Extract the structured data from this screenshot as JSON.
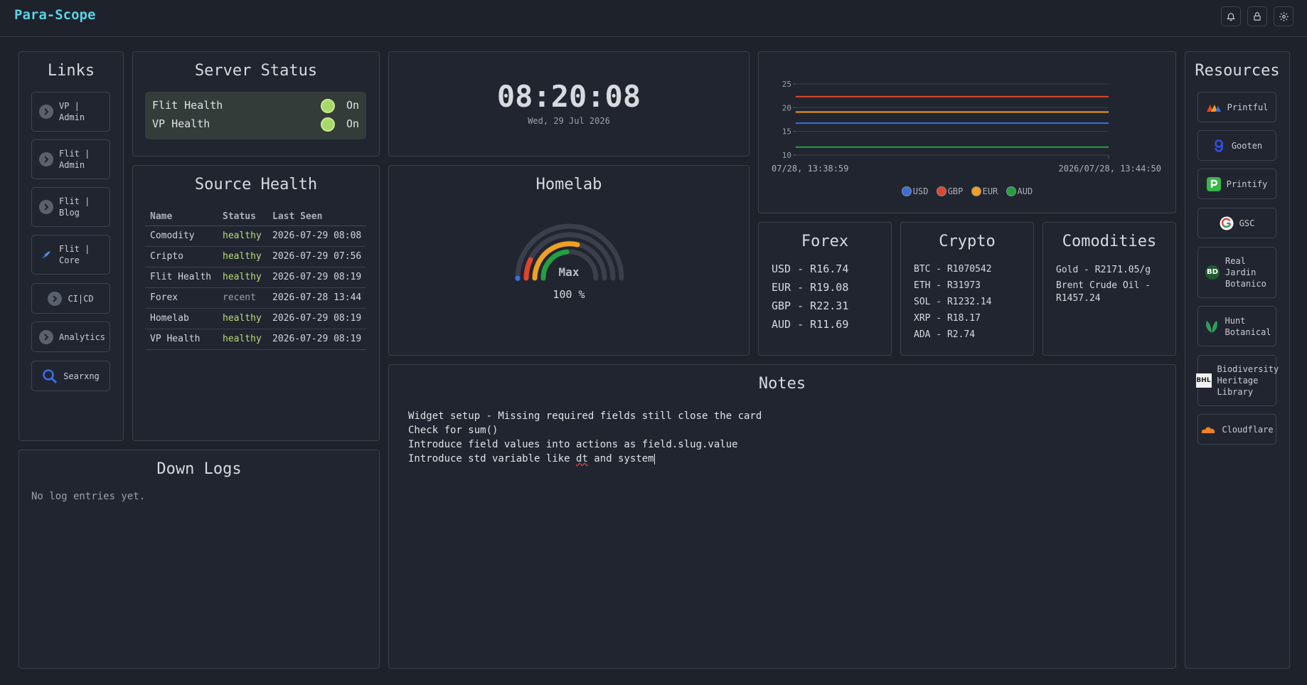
{
  "app": {
    "title": "Para-Scope"
  },
  "links": {
    "title": "Links",
    "items": [
      {
        "label": "VP | Admin",
        "icon": "chevron-right-icon"
      },
      {
        "label": "Flit | Admin",
        "icon": "chevron-right-icon"
      },
      {
        "label": "Flit | Blog",
        "icon": "chevron-right-icon"
      },
      {
        "label": "Flit | Core",
        "icon": "bird-icon"
      },
      {
        "label": "CI|CD",
        "icon": "chevron-right-icon"
      },
      {
        "label": "Analytics",
        "icon": "chevron-right-icon"
      },
      {
        "label": "Searxng",
        "icon": "search-icon"
      }
    ]
  },
  "server_status": {
    "title": "Server Status",
    "rows": [
      {
        "name": "Flit Health",
        "state": "On"
      },
      {
        "name": "VP Health",
        "state": "On"
      }
    ]
  },
  "source_health": {
    "title": "Source Health",
    "columns": [
      "Name",
      "Status",
      "Last Seen"
    ],
    "rows": [
      {
        "name": "Comodity",
        "status": "healthy",
        "last_seen": "2026-07-29 08:08"
      },
      {
        "name": "Cripto",
        "status": "healthy",
        "last_seen": "2026-07-29 07:56"
      },
      {
        "name": "Flit Health",
        "status": "healthy",
        "last_seen": "2026-07-29 08:19"
      },
      {
        "name": "Forex",
        "status": "recent",
        "last_seen": "2026-07-28 13:44"
      },
      {
        "name": "Homelab",
        "status": "healthy",
        "last_seen": "2026-07-29 08:19"
      },
      {
        "name": "VP Health",
        "status": "healthy",
        "last_seen": "2026-07-29 08:19"
      }
    ]
  },
  "clock": {
    "time": "08:20:08",
    "date": "Wed, 29 Jul 2026"
  },
  "homelab": {
    "title": "Homelab",
    "gauge_label": "Max",
    "gauge_value_text": "100 %",
    "gauge_value": 100
  },
  "chart_data": {
    "type": "line",
    "x_range_labels": [
      "07/28, 13:38:59",
      "2026/07/28, 13:44:50"
    ],
    "yticks": [
      10,
      15,
      20,
      25
    ],
    "ylim": [
      10,
      25
    ],
    "series": [
      {
        "name": "USD",
        "values": [
          16.74,
          16.74
        ],
        "color": "#3b6fd6"
      },
      {
        "name": "GBP",
        "values": [
          22.31,
          22.31
        ],
        "color": "#e0442c"
      },
      {
        "name": "EUR",
        "values": [
          19.08,
          19.08
        ],
        "color": "#f0a020"
      },
      {
        "name": "AUD",
        "values": [
          11.69,
          11.69
        ],
        "color": "#22a040"
      }
    ],
    "grid": true,
    "legend": "bottom"
  },
  "forex": {
    "title": "Forex",
    "items": [
      "USD - R16.74",
      "EUR - R19.08",
      "GBP - R22.31",
      "AUD - R11.69"
    ]
  },
  "crypto": {
    "title": "Crypto",
    "items": [
      "BTC - R1070542",
      "ETH - R31973",
      "SOL - R1232.14",
      "XRP - R18.17",
      "ADA - R2.74"
    ]
  },
  "commodities": {
    "title": "Comodities",
    "items": [
      "Gold - R2171.05/g",
      "Brent Crude Oil - R1457.24"
    ]
  },
  "resources": {
    "title": "Resources",
    "items": [
      {
        "label": "Printful",
        "icon": "printful-logo-icon"
      },
      {
        "label": "Gooten",
        "icon": "gooten-logo-icon"
      },
      {
        "label": "Printify",
        "icon": "printify-logo-icon"
      },
      {
        "label": "GSC",
        "icon": "google-logo-icon"
      },
      {
        "label": "Real Jardin Botanico",
        "icon": "bd-logo-icon",
        "logo_text": "BD"
      },
      {
        "label": "Hunt Botanical",
        "icon": "leaf-logo-icon"
      },
      {
        "label": "Biodiversity Heritage Library",
        "icon": "bhl-logo-icon",
        "logo_text": "BHL"
      },
      {
        "label": "Cloudflare",
        "icon": "cloudflare-logo-icon"
      }
    ]
  },
  "down_logs": {
    "title": "Down Logs",
    "empty_text": "No log entries yet."
  },
  "notes": {
    "title": "Notes",
    "line1": "Widget setup - Missing required fields still close the card",
    "line2": "Check for sum()",
    "line3": "Introduce field values into actions as field.slug.value",
    "line4_pre": "Introduce std variable like ",
    "line4_ul": "dt",
    "line4_post": " and system"
  }
}
